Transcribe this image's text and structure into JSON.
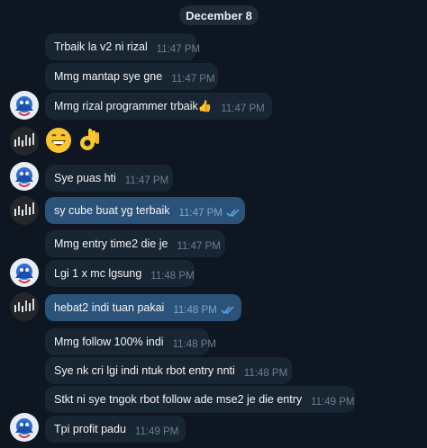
{
  "date_separator": "December 8",
  "messages": [
    {
      "text": "Trbaik la v2 ni rizal",
      "time": "11:47 PM"
    },
    {
      "text": "Mmg mantap sye gne",
      "time": "11:47 PM"
    },
    {
      "text": "Mmg rizal programmer trbaik👍",
      "time": "11:47 PM"
    },
    {
      "emojis": "😁👌"
    },
    {
      "text": "Sye puas hti",
      "time": "11:47 PM"
    },
    {
      "text": "sy cube buat yg terbaik",
      "time": "11:47 PM"
    },
    {
      "text": "Mmg entry time2 die je",
      "time": "11:47 PM"
    },
    {
      "text": "Lgi 1 x mc lgsung",
      "time": "11:48 PM"
    },
    {
      "text": "hebat2 indi tuan pakai",
      "time": "11:48 PM"
    },
    {
      "text": "Mmg follow 100% indi",
      "time": "11:48 PM"
    },
    {
      "text": "Sye nk cri lgi indi ntuk rbot entry nnti",
      "time": "11:48 PM"
    },
    {
      "text": "Stkt ni sye tngok rbot follow ade mse2 je die entry",
      "time": "11:49 PM"
    },
    {
      "text": "Tpi profit padu",
      "time": "11:49 PM"
    }
  ],
  "colors": {
    "background": "#0e1621",
    "incoming_bubble": "#182533",
    "outgoing_bubble": "#2b5278",
    "read_ticks": "#5fa8e8"
  }
}
